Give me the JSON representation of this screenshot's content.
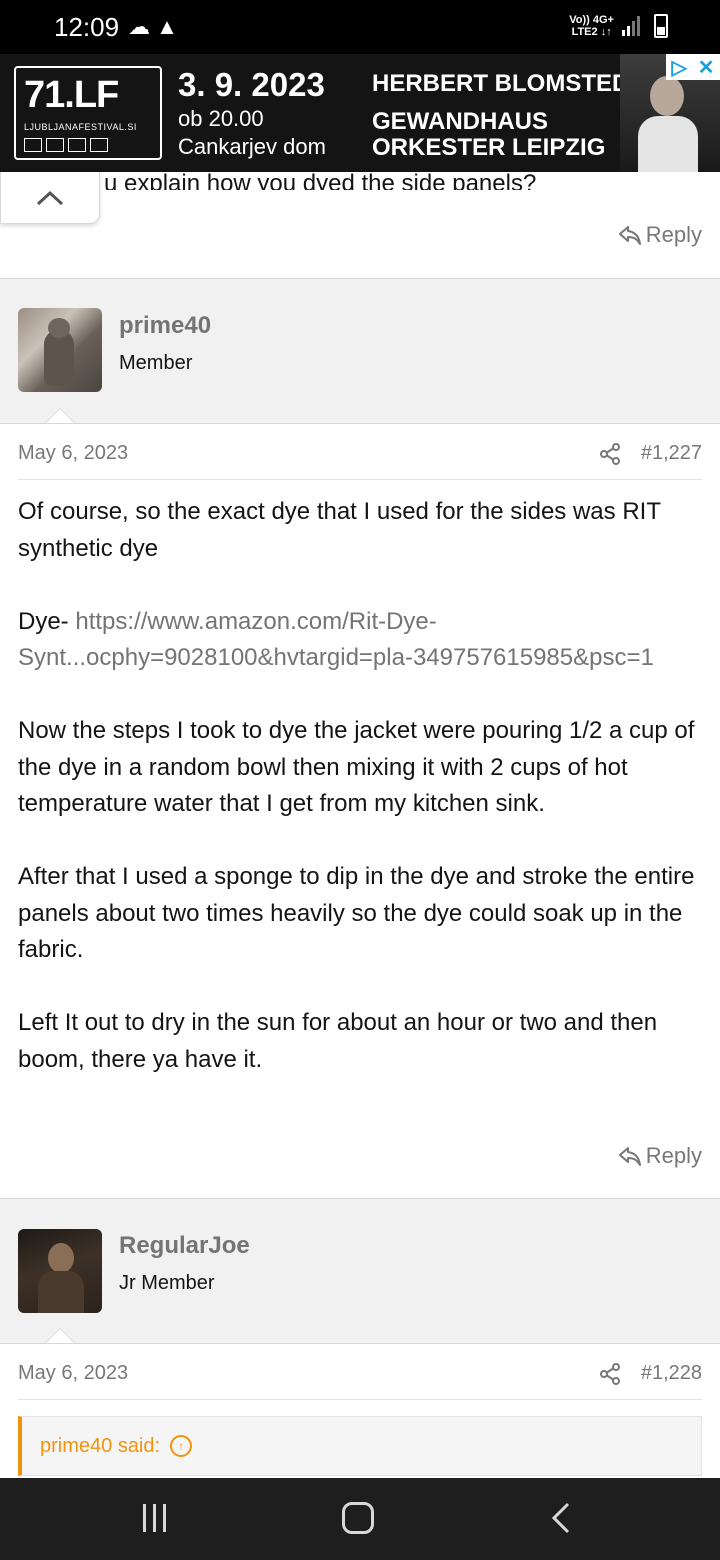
{
  "status_bar": {
    "time": "12:09",
    "left_icons": "☁ ▲",
    "network_top": "Vo)) 4G+",
    "network_bottom": "LTE2 ↓↑"
  },
  "ad": {
    "logo_main": "71.LF",
    "logo_sub": "LJUBLJANAFESTIVAL.SI",
    "date": "3. 9. 2023",
    "time": "ob 20.00",
    "venue": "Cankarjev dom",
    "line1": "HERBERT BLOMSTEDT",
    "line2": "GEWANDHAUS",
    "line3": "ORKESTER LEIPZIG"
  },
  "previous_post": {
    "cut_text": "u explain how you dyed the side panels?",
    "reply_label": "Reply"
  },
  "posts": [
    {
      "username": "prime40",
      "user_title": "Member",
      "date": "May 6, 2023",
      "number": "#1,227",
      "body": {
        "p1": "Of course, so the exact dye that I used for the sides was RIT synthetic dye",
        "p2_prefix": "Dye- ",
        "p2_link": "https://www.amazon.com/Rit-Dye-Synt...ocphy=9028100&hvtargid=pla-349757615985&psc=1",
        "p3": "Now the steps I took to dye the jacket were pouring 1/2 a cup of the dye in a random bowl then mixing it with 2 cups of hot temperature water that I get from my kitchen sink.",
        "p4": "After that I used a sponge to dip in the dye and stroke the entire panels about two times heavily so the dye could soak up in the fabric.",
        "p5": "Left It out to dry in the sun for about an hour or two and then boom, there ya have it."
      },
      "reply_label": "Reply"
    },
    {
      "username": "RegularJoe",
      "user_title": "Jr Member",
      "date": "May 6, 2023",
      "number": "#1,228",
      "quote_label": "prime40 said:"
    }
  ],
  "colors": {
    "accent_orange": "#f2930d",
    "muted_text": "#747474",
    "band_bg": "#f1f1f1"
  }
}
